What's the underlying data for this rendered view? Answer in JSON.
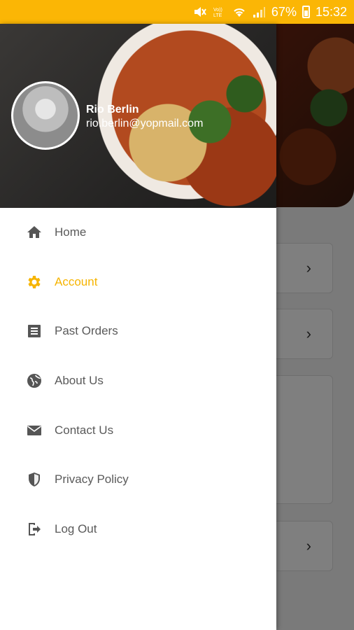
{
  "status_bar": {
    "battery": "67%",
    "time": "15:32"
  },
  "user": {
    "name": "Rio Berlin",
    "email": "rio.berlin@yopmail.com"
  },
  "menu": {
    "items": [
      {
        "label": "Home",
        "icon": "home-icon"
      },
      {
        "label": "Account",
        "icon": "gear-icon",
        "active": true
      },
      {
        "label": "Past Orders",
        "icon": "list-icon"
      },
      {
        "label": "About Us",
        "icon": "globe-icon"
      },
      {
        "label": "Contact Us",
        "icon": "mail-icon"
      },
      {
        "label": "Privacy Policy",
        "icon": "shield-icon"
      },
      {
        "label": "Log Out",
        "icon": "logout-icon"
      }
    ]
  },
  "colors": {
    "accent": "#F6B400",
    "status_bar": "#FBB605",
    "menu_text": "#5a5a5a",
    "icon": "#555555"
  }
}
